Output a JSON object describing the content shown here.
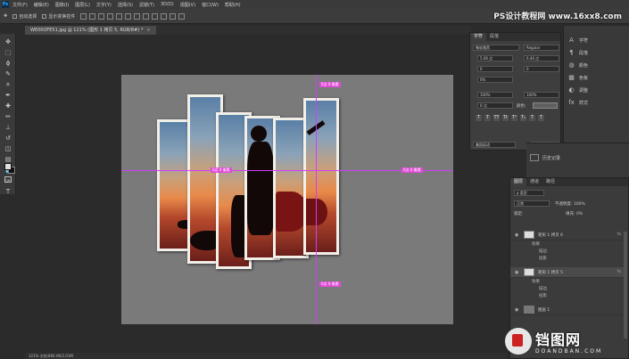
{
  "menubar": {
    "logo": "Ps",
    "items": [
      "文件(F)",
      "编辑(E)",
      "图像(I)",
      "图层(L)",
      "文字(Y)",
      "选择(S)",
      "滤镜(T)",
      "3D(D)",
      "视图(V)",
      "窗口(W)",
      "帮助(H)"
    ]
  },
  "options": {
    "auto_select": "自动选择",
    "show_transform": "显示变换控件"
  },
  "watermark_top": "PS设计教程网 www.16xx8.com",
  "document_tab": {
    "name": "WE00OFE51.jpg @ 121% (图形 1 拷贝 5, RGB/8#) *",
    "close": "×"
  },
  "canvas": {
    "smart_labels": [
      "0点 0 像素",
      "0点 0 像素",
      "0点 0 像素",
      "0点 0 像素"
    ]
  },
  "character_panel": {
    "tabs": [
      "字符",
      "段落"
    ],
    "font_family": "微软雅黑",
    "font_style": "Regular",
    "size": "5.06 点",
    "leading": "6.44 点",
    "tracking": "0",
    "kerning": "0%",
    "vertical_scale": "100%",
    "horizontal_scale": "100%",
    "baseline": "0 点",
    "color_label": "颜色:",
    "language": "美国英语",
    "aa": "锐利",
    "style_buttons": [
      "T",
      "T",
      "TT",
      "Tt",
      "T¹",
      "T₁",
      "T",
      "T"
    ]
  },
  "right_mini": {
    "items": [
      {
        "icon": "A",
        "label": "字符"
      },
      {
        "icon": "¶",
        "label": "段落"
      },
      {
        "icon": "◍",
        "label": "颜色"
      },
      {
        "icon": "▦",
        "label": "色板"
      },
      {
        "icon": "◐",
        "label": "调整"
      },
      {
        "icon": "fx",
        "label": "样式"
      }
    ],
    "history_label": "历史记录"
  },
  "layers": {
    "tabs": [
      "图层",
      "通道",
      "路径"
    ],
    "kind_label": "ρ 类型",
    "blend_mode": "正常",
    "opacity_label": "不透明度: 100%",
    "lock_label": "锁定:",
    "fill_label": "填充: 0%",
    "rows": [
      {
        "name": "矩形 1 拷贝 6",
        "fx": "fx"
      },
      {
        "name": "矩形 1 拷贝 5",
        "fx": "fx"
      },
      {
        "name": "图层 1",
        "fx": ""
      }
    ],
    "effects": [
      "效果",
      "描边",
      "投影"
    ]
  },
  "status": "121%   文档:864.0K/2.01M",
  "watermark_bottom": {
    "cn": "铛图网",
    "en": "DOANDBAN.COM"
  }
}
